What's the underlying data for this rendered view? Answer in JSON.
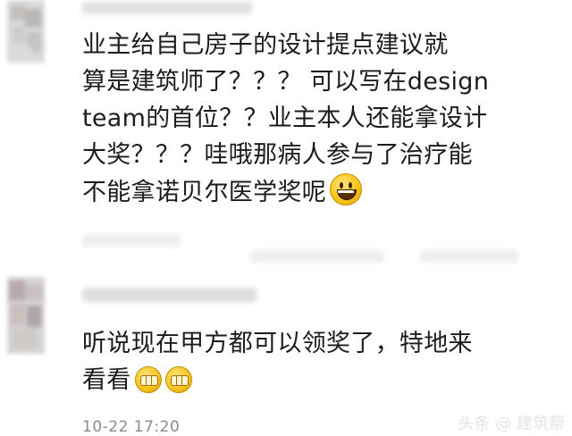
{
  "comments": [
    {
      "lines": [
        "业主给自己房子的设计提点建议就",
        "算是建筑师了？？？ 可以写在design",
        "team的首位？？业主本人还能拿设计",
        "大奖？？？哇哦那病人参与了治疗能",
        "不能拿诺贝尔医学奖呢"
      ],
      "emoji": "smile-icon"
    },
    {
      "lines": [
        "听说现在甲方都可以领奖了，特地来",
        "看看"
      ],
      "emoji": "grin-icon"
    }
  ],
  "timestamp": "10-22 17:20",
  "watermark": "头条 @ 建筑帮"
}
